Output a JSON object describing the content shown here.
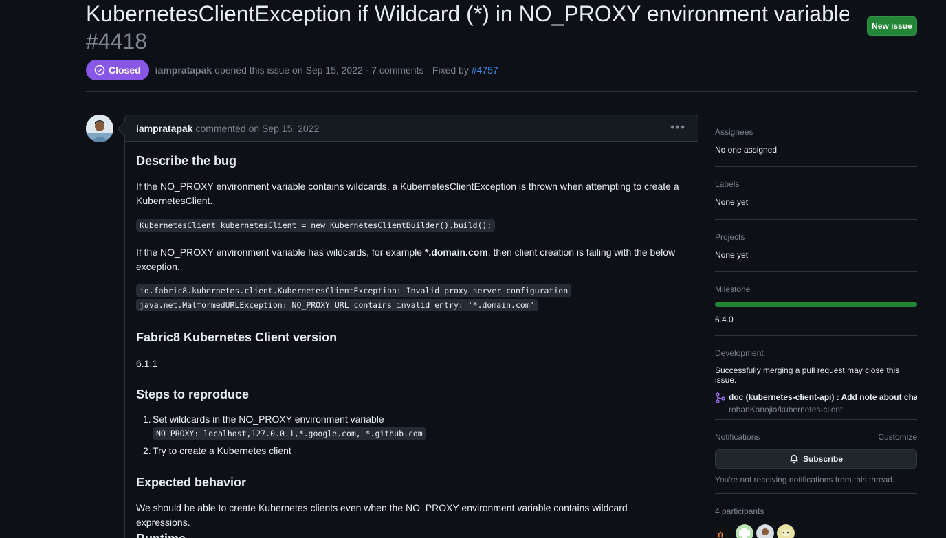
{
  "header": {
    "title": "KubernetesClientException if Wildcard (*) in NO_PROXY environment variable",
    "number": "#4418",
    "new_issue_label": "New issue",
    "state": "Closed",
    "author": "iampratapak",
    "opened_text": "opened this issue on Sep 15, 2022 · 7 comments · Fixed by",
    "fixed_by": "#4757"
  },
  "comment": {
    "author": "iampratapak",
    "when": "commented on Sep 15, 2022",
    "menu_label": "•••",
    "h_bug": "Describe the bug",
    "p_bug": "If the NO_PROXY environment variable contains wildcards, a KubernetesClientException is thrown when attempting to create a KubernetesClient.",
    "code_build": "KubernetesClient kubernetesClient = new KubernetesClientBuilder().build();",
    "p_example_pre": "If the NO_PROXY environment variable has wildcards, for example ",
    "p_example_bold": "*.domain.com",
    "p_example_post": ", then client creation is failing with the below exception.",
    "code_ex1": "io.fabric8.kubernetes.client.KubernetesClientException: Invalid proxy server configuration",
    "code_ex2": "java.net.MalformedURLException: NO_PROXY URL contains invalid entry: '*.domain.com'",
    "h_version": "Fabric8 Kubernetes Client version",
    "version": "6.1.1",
    "h_steps": "Steps to reproduce",
    "step1_num": "1.",
    "step1": "Set wildcards in the NO_PROXY environment variable",
    "step1_code": "NO_PROXY: localhost,127.0.0.1,*.google.com, *.github.com",
    "step2_num": "2.",
    "step2": "Try to create a Kubernetes client",
    "h_expected": "Expected behavior",
    "p_expected": "We should be able to create Kubernetes clients even when the NO_PROXY environment variable contains wildcard expressions.",
    "h_runtime": "Runtime"
  },
  "sidebar": {
    "assignees_label": "Assignees",
    "assignees_value": "No one assigned",
    "labels_label": "Labels",
    "labels_value": "None yet",
    "projects_label": "Projects",
    "projects_value": "None yet",
    "milestone_label": "Milestone",
    "milestone_value": "6.4.0",
    "milestone_progress": 1.0,
    "development_label": "Development",
    "development_text": "Successfully merging a pull request may close this issue.",
    "pr_title": "doc (kubernetes-client-api) : Add note about cha...",
    "pr_repo": "rohanKanojia/kubernetes-client",
    "notifications_label": "Notifications",
    "customize_label": "Customize",
    "subscribe_label": "Subscribe",
    "notifications_text": "You're not receiving notifications from this thread.",
    "participants_label": "4 participants"
  },
  "colors": {
    "background": "#0d1117",
    "closed_badge": "#8957e5",
    "new_issue": "#238636",
    "link": "#4493f8",
    "muted": "#7d8590"
  }
}
